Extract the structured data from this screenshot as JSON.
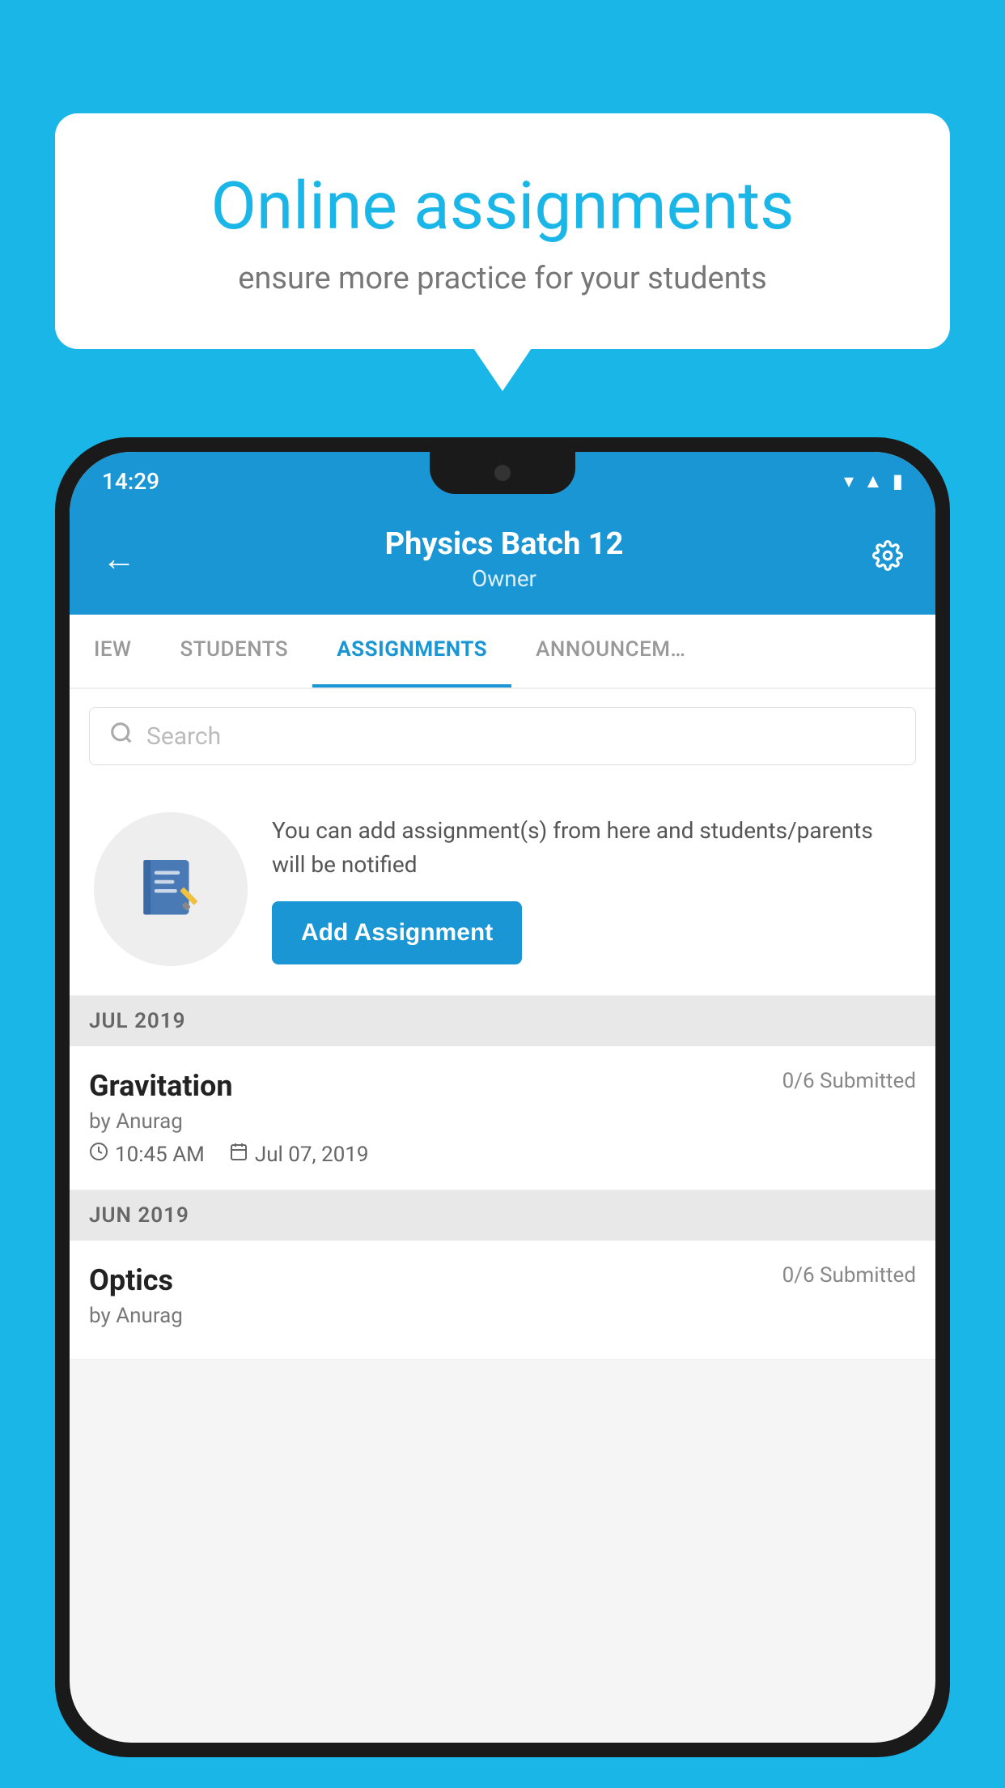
{
  "background_color": "#1ab6e8",
  "speech_bubble": {
    "title": "Online assignments",
    "subtitle": "ensure more practice for your students"
  },
  "phone": {
    "status_bar": {
      "time": "14:29",
      "icons": [
        "wifi",
        "signal",
        "battery"
      ]
    },
    "header": {
      "title": "Physics Batch 12",
      "subtitle": "Owner",
      "back_label": "←",
      "settings_label": "⚙"
    },
    "tabs": [
      {
        "label": "IEW",
        "active": false
      },
      {
        "label": "STUDENTS",
        "active": false
      },
      {
        "label": "ASSIGNMENTS",
        "active": true
      },
      {
        "label": "ANNOUNCEM…",
        "active": false
      }
    ],
    "search": {
      "placeholder": "Search"
    },
    "promo": {
      "text": "You can add assignment(s) from here and students/parents will be notified",
      "button_label": "Add Assignment"
    },
    "sections": [
      {
        "label": "JUL 2019",
        "items": [
          {
            "title": "Gravitation",
            "submitted": "0/6 Submitted",
            "by": "by Anurag",
            "time": "10:45 AM",
            "date": "Jul 07, 2019"
          }
        ]
      },
      {
        "label": "JUN 2019",
        "items": [
          {
            "title": "Optics",
            "submitted": "0/6 Submitted",
            "by": "by Anurag",
            "time": "",
            "date": ""
          }
        ]
      }
    ]
  }
}
